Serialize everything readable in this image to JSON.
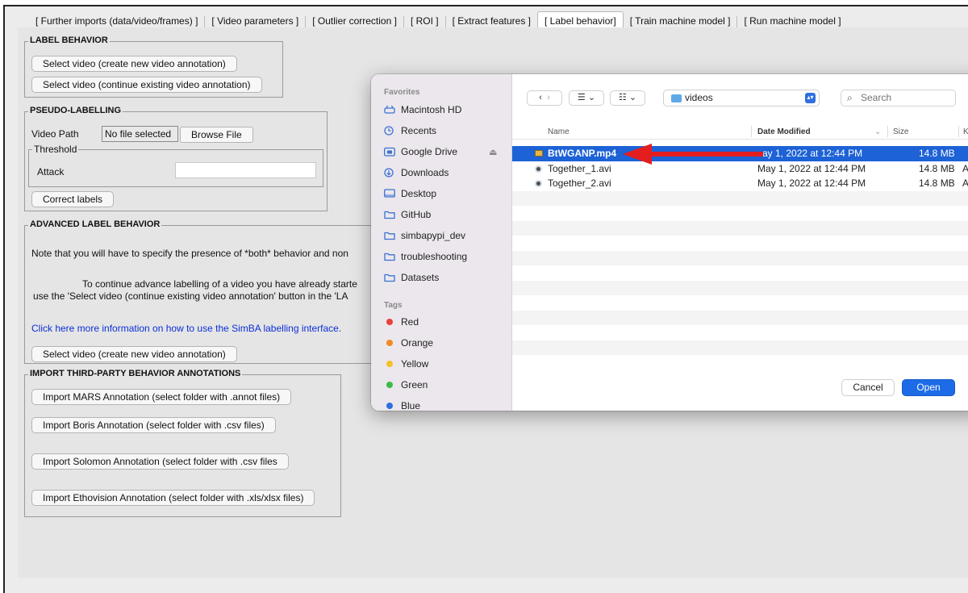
{
  "tabs": [
    {
      "label": "[ Further imports (data/video/frames) ]"
    },
    {
      "label": "[ Video parameters ]"
    },
    {
      "label": "[ Outlier correction ]"
    },
    {
      "label": "[ ROI ]"
    },
    {
      "label": "[ Extract features ]"
    },
    {
      "label": "[ Label behavior]",
      "active": true
    },
    {
      "label": "[ Train machine model ]"
    },
    {
      "label": "[ Run machine model ]"
    }
  ],
  "label_behavior": {
    "title": "LABEL BEHAVIOR",
    "select_new": "Select video (create new video annotation)",
    "select_continue": "Select video (continue existing video annotation)"
  },
  "pseudo": {
    "title": "PSEUDO-LABELLING",
    "video_path_label": "Video Path",
    "path_value": "No file selected",
    "browse": "Browse File",
    "threshold_title": "Threshold",
    "attack_label": "Attack",
    "attack_value": "",
    "correct": "Correct labels"
  },
  "advanced": {
    "title": "ADVANCED LABEL BEHAVIOR",
    "note": "Note that you will have to specify the presence of *both* behavior and non",
    "continue_line1": "To continue advance labelling of a video you have already starte",
    "continue_line2": "use the 'Select video (continue existing video annotation' button in the 'LA",
    "link": "Click here more information on how to use the SimBA labelling interface.",
    "select_new": "Select video (create new video annotation)"
  },
  "third_party": {
    "title": "IMPORT THIRD-PARTY BEHAVIOR ANNOTATIONS",
    "mars": "Import MARS Annotation (select folder with .annot files)",
    "boris": "Import Boris Annotation (select folder with .csv files)",
    "solomon": "Import Solomon Annotation (select folder with .csv files",
    "ethovision": "Import Ethovision Annotation (select folder with .xls/xlsx files)"
  },
  "dialog": {
    "favorites_header": "Favorites",
    "favorites": [
      {
        "label": "Macintosh HD",
        "icon": "drive-icon"
      },
      {
        "label": "Recents",
        "icon": "clock-icon"
      },
      {
        "label": "Google Drive",
        "icon": "drive-folder-icon",
        "eject": "⏏"
      },
      {
        "label": "Downloads",
        "icon": "download-icon"
      },
      {
        "label": "Desktop",
        "icon": "desktop-icon"
      },
      {
        "label": "GitHub",
        "icon": "folder-icon"
      },
      {
        "label": "simbapypi_dev",
        "icon": "folder-icon"
      },
      {
        "label": "troubleshooting",
        "icon": "folder-icon"
      },
      {
        "label": "Datasets",
        "icon": "folder-icon"
      }
    ],
    "tags_header": "Tags",
    "tags": [
      {
        "label": "Red",
        "color": "#e8413b"
      },
      {
        "label": "Orange",
        "color": "#f08a24"
      },
      {
        "label": "Yellow",
        "color": "#f4c02b"
      },
      {
        "label": "Green",
        "color": "#3dbb4a"
      },
      {
        "label": "Blue",
        "color": "#2f6fe0"
      }
    ],
    "location": "videos",
    "search_placeholder": "Search",
    "columns": {
      "name": "Name",
      "date": "Date Modified",
      "size": "Size",
      "kind": "K"
    },
    "files": [
      {
        "name": "BtWGANP.mp4",
        "date": "ay 1, 2022 at 12:44 PM",
        "size": "14.8 MB",
        "kind": "",
        "selected": true
      },
      {
        "name": "Together_1.avi",
        "date": "May 1, 2022 at 12:44 PM",
        "size": "14.8 MB",
        "kind": "A"
      },
      {
        "name": "Together_2.avi",
        "date": "May 1, 2022 at 12:44 PM",
        "size": "14.8 MB",
        "kind": "A"
      }
    ],
    "cancel": "Cancel",
    "open": "Open"
  },
  "colors": {
    "accent": "#1d6be6",
    "selection": "#1d62d6",
    "arrow": "#e41e1e",
    "link": "#0b2fd6"
  }
}
